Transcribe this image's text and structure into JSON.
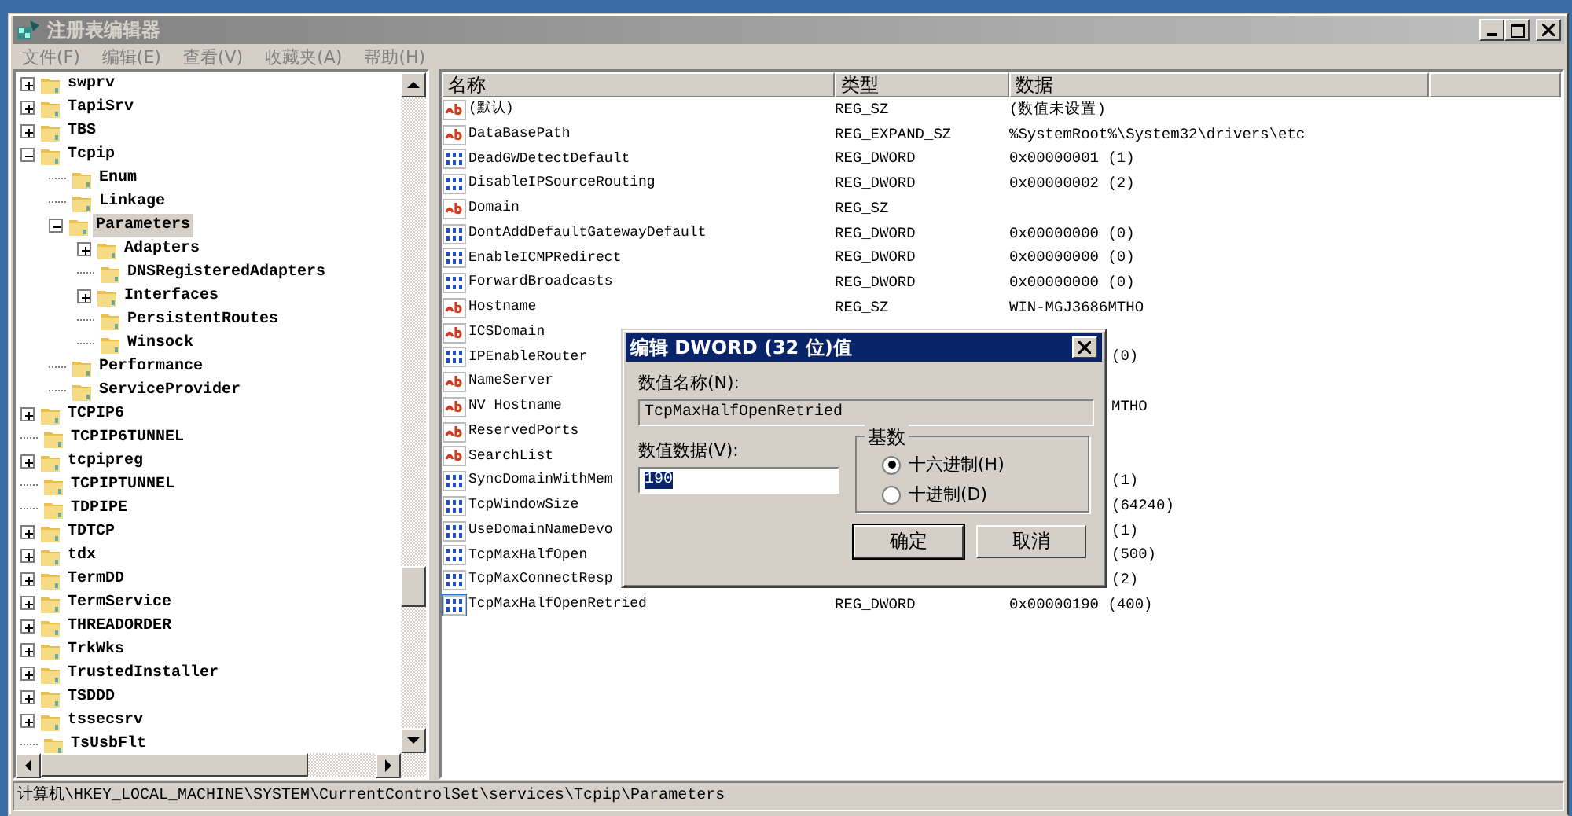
{
  "window": {
    "title": "注册表编辑器"
  },
  "menu": [
    "文件(F)",
    "编辑(E)",
    "查看(V)",
    "收藏夹(A)",
    "帮助(H)"
  ],
  "tree": [
    {
      "label": "swprv",
      "expanded": false,
      "selected": false
    },
    {
      "label": "TapiSrv",
      "expanded": false,
      "selected": false
    },
    {
      "label": "TBS",
      "expanded": false,
      "selected": false
    },
    {
      "label": "Tcpip",
      "expanded": true,
      "selected": false,
      "children": [
        {
          "label": "Enum",
          "selected": false
        },
        {
          "label": "Linkage",
          "selected": false
        },
        {
          "label": "Parameters",
          "expanded": true,
          "selected": true,
          "children": [
            {
              "label": "Adapters",
              "expanded": false,
              "selected": false
            },
            {
              "label": "DNSRegisteredAdapters",
              "selected": false
            },
            {
              "label": "Interfaces",
              "expanded": false,
              "selected": false
            },
            {
              "label": "PersistentRoutes",
              "selected": false
            },
            {
              "label": "Winsock",
              "selected": false
            }
          ]
        },
        {
          "label": "Performance",
          "selected": false
        },
        {
          "label": "ServiceProvider",
          "selected": false
        }
      ]
    },
    {
      "label": "TCPIP6",
      "expanded": false,
      "selected": false
    },
    {
      "label": "TCPIP6TUNNEL",
      "selected": false
    },
    {
      "label": "tcpipreg",
      "expanded": false,
      "selected": false
    },
    {
      "label": "TCPIPTUNNEL",
      "selected": false
    },
    {
      "label": "TDPIPE",
      "selected": false
    },
    {
      "label": "TDTCP",
      "expanded": false,
      "selected": false
    },
    {
      "label": "tdx",
      "expanded": false,
      "selected": false
    },
    {
      "label": "TermDD",
      "expanded": false,
      "selected": false
    },
    {
      "label": "TermService",
      "expanded": false,
      "selected": false
    },
    {
      "label": "THREADORDER",
      "expanded": false,
      "selected": false
    },
    {
      "label": "TrkWks",
      "expanded": false,
      "selected": false
    },
    {
      "label": "TrustedInstaller",
      "expanded": false,
      "selected": false
    },
    {
      "label": "TSDDD",
      "expanded": false,
      "selected": false
    },
    {
      "label": "tssecsrv",
      "expanded": false,
      "selected": false
    },
    {
      "label": "TsUsbFlt",
      "selected": false
    }
  ],
  "table": {
    "columns": [
      "名称",
      "类型",
      "数据"
    ],
    "rows": [
      {
        "kind": "string",
        "name": "(默认)",
        "type": "REG_SZ",
        "data": "(数值未设置)",
        "selected": false
      },
      {
        "kind": "string",
        "name": "DataBasePath",
        "type": "REG_EXPAND_SZ",
        "data": "%SystemRoot%\\System32\\drivers\\etc",
        "selected": false
      },
      {
        "kind": "dword",
        "name": "DeadGWDetectDefault",
        "type": "REG_DWORD",
        "data": "0x00000001 (1)",
        "selected": false
      },
      {
        "kind": "dword",
        "name": "DisableIPSourceRouting",
        "type": "REG_DWORD",
        "data": "0x00000002 (2)",
        "selected": false
      },
      {
        "kind": "string",
        "name": "Domain",
        "type": "REG_SZ",
        "selected": false
      },
      {
        "kind": "dword",
        "name": "DontAddDefaultGatewayDefault",
        "type": "REG_DWORD",
        "data": "0x00000000 (0)",
        "selected": false
      },
      {
        "kind": "dword",
        "name": "EnableICMPRedirect",
        "type": "REG_DWORD",
        "data": "0x00000000 (0)",
        "selected": false
      },
      {
        "kind": "dword",
        "name": "ForwardBroadcasts",
        "type": "REG_DWORD",
        "data": "0x00000000 (0)",
        "selected": false
      },
      {
        "kind": "string",
        "name": "Hostname",
        "type": "REG_SZ",
        "data": "WIN-MGJ3686MTHO",
        "selected": false
      },
      {
        "kind": "string",
        "name": "ICSDomain",
        "covered": true,
        "selected": false
      },
      {
        "kind": "dword",
        "name": "IPEnableRouter",
        "covered": true,
        "data": "(0)",
        "selected": false
      },
      {
        "kind": "string",
        "name": "NameServer",
        "covered": true,
        "selected": false
      },
      {
        "kind": "string",
        "name": "NV Hostname",
        "covered": true,
        "data": "MTHO",
        "selected": false
      },
      {
        "kind": "string",
        "name": "ReservedPorts",
        "covered": true,
        "selected": false
      },
      {
        "kind": "string",
        "name": "SearchList",
        "covered": true,
        "selected": false
      },
      {
        "kind": "dword",
        "name": "SyncDomainWithMem",
        "covered": true,
        "data": "(1)",
        "selected": false
      },
      {
        "kind": "dword",
        "name": "TcpWindowSize",
        "covered": true,
        "data": "(64240)",
        "selected": false
      },
      {
        "kind": "dword",
        "name": "UseDomainNameDevo",
        "covered": true,
        "data": "(1)",
        "selected": false
      },
      {
        "kind": "dword",
        "name": "TcpMaxHalfOpen",
        "covered": true,
        "data": "(500)",
        "selected": false
      },
      {
        "kind": "dword",
        "name": "TcpMaxConnectResp",
        "covered": true,
        "data": "(2)",
        "selected": false
      },
      {
        "kind": "dword",
        "name": "TcpMaxHalfOpenRetried",
        "type": "REG_DWORD",
        "data": "0x00000190 (400)",
        "selected": true
      }
    ]
  },
  "status_bar": "计算机\\HKEY_LOCAL_MACHINE\\SYSTEM\\CurrentControlSet\\services\\Tcpip\\Parameters",
  "dialog": {
    "title": "编辑 DWORD (32 位)值",
    "name_label": "数值名称(N):",
    "name_value": "TcpMaxHalfOpenRetried",
    "data_label": "数值数据(V):",
    "data_value": "190",
    "base_label": "基数",
    "bases": [
      {
        "label": "十六进制(H)",
        "selected": true
      },
      {
        "label": "十进制(D)",
        "selected": false
      }
    ],
    "buttons": [
      {
        "label": "确定",
        "default": true
      },
      {
        "label": "取消",
        "default": false
      }
    ]
  }
}
